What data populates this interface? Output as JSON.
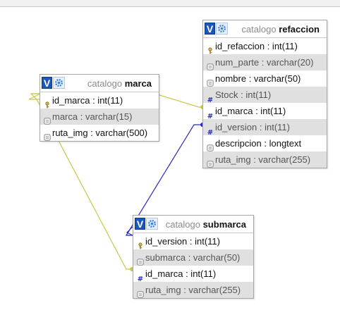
{
  "colors": {
    "link_yellow": "#c8c84a",
    "link_blue": "#2a2ab8",
    "header_button": "#1a57b8"
  },
  "tables": {
    "marca": {
      "schema": "catalogo",
      "name": "marca",
      "rows": [
        {
          "label": "id_marca : int(11)",
          "icon": "key-icon",
          "shade": false
        },
        {
          "label": "marca : varchar(15)",
          "icon": "string-column-icon",
          "shade": true
        },
        {
          "label": "ruta_img : varchar(500)",
          "icon": "string-column-icon",
          "shade": false
        }
      ]
    },
    "refaccion": {
      "schema": "catalogo",
      "name": "refaccion",
      "rows": [
        {
          "label": "id_refaccion : int(11)",
          "icon": "key-icon",
          "shade": false
        },
        {
          "label": "num_parte : varchar(20)",
          "icon": "string-column-icon",
          "shade": true
        },
        {
          "label": "nombre : varchar(50)",
          "icon": "string-column-icon",
          "shade": false
        },
        {
          "label": "Stock : int(11)",
          "icon": "numeric-column-icon",
          "shade": true
        },
        {
          "label": "id_marca : int(11)",
          "icon": "numeric-column-icon",
          "shade": false
        },
        {
          "label": "id_version : int(11)",
          "icon": "numeric-column-icon",
          "shade": true
        },
        {
          "label": "descripcion : longtext",
          "icon": "string-column-icon",
          "shade": false
        },
        {
          "label": "ruta_img : varchar(255)",
          "icon": "string-column-icon",
          "shade": true
        }
      ]
    },
    "submarca": {
      "schema": "catalogo",
      "name": "submarca",
      "rows": [
        {
          "label": "id_version : int(11)",
          "icon": "key-icon",
          "shade": false
        },
        {
          "label": "submarca : varchar(50)",
          "icon": "string-column-icon",
          "shade": true
        },
        {
          "label": "id_marca : int(11)",
          "icon": "numeric-column-icon",
          "shade": false
        },
        {
          "label": "ruta_img : varchar(255)",
          "icon": "string-column-icon",
          "shade": true
        }
      ]
    }
  },
  "header_buttons": {
    "v_label": "V"
  }
}
